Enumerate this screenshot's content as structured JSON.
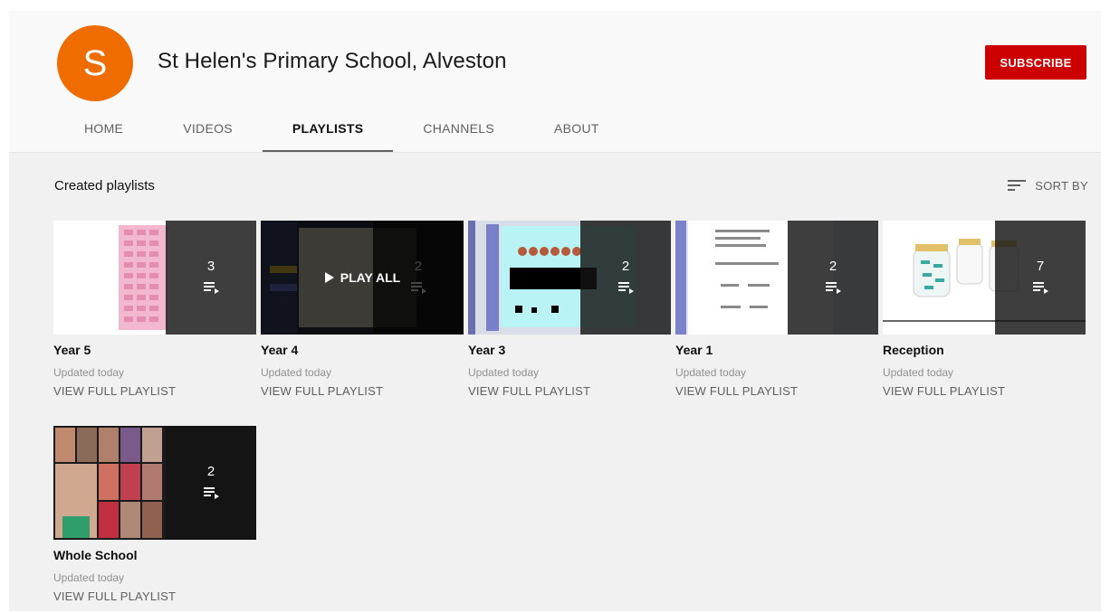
{
  "channel": {
    "avatar_letter": "S",
    "name": "St Helen's Primary School, Alveston",
    "subscribe_label": "SUBSCRIBE",
    "accent_color": "#cc0000",
    "avatar_color": "#ef6c00"
  },
  "tabs": [
    {
      "label": "HOME",
      "active": false
    },
    {
      "label": "VIDEOS",
      "active": false
    },
    {
      "label": "PLAYLISTS",
      "active": true
    },
    {
      "label": "CHANNELS",
      "active": false
    },
    {
      "label": "ABOUT",
      "active": false
    }
  ],
  "section": {
    "title": "Created playlists",
    "sort_label": "SORT BY",
    "sort_icon": "sort-icon"
  },
  "playlists": [
    {
      "title": "Year 5",
      "count": "3",
      "updated": "Updated today",
      "link": "VIEW FULL PLAYLIST",
      "hovered": false
    },
    {
      "title": "Year 4",
      "count": "2",
      "updated": "Updated today",
      "link": "VIEW FULL PLAYLIST",
      "hovered": true,
      "play_all_label": "PLAY ALL"
    },
    {
      "title": "Year 3",
      "count": "2",
      "updated": "Updated today",
      "link": "VIEW FULL PLAYLIST",
      "hovered": false
    },
    {
      "title": "Year 1",
      "count": "2",
      "updated": "Updated today",
      "link": "VIEW FULL PLAYLIST",
      "hovered": false
    },
    {
      "title": "Reception",
      "count": "7",
      "updated": "Updated today",
      "link": "VIEW FULL PLAYLIST",
      "hovered": false
    },
    {
      "title": "Whole School",
      "count": "2",
      "updated": "Updated today",
      "link": "VIEW FULL PLAYLIST",
      "hovered": false
    }
  ]
}
